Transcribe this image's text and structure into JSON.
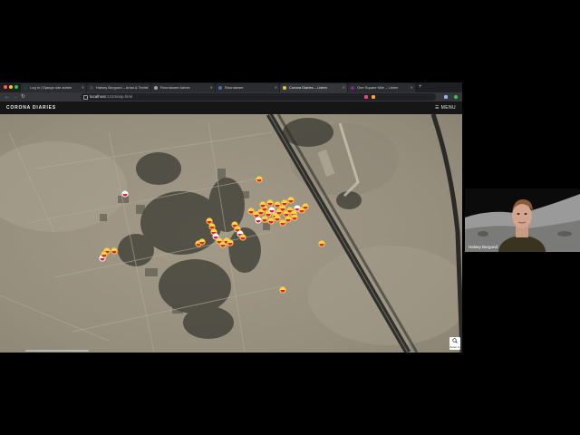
{
  "browser": {
    "traffic_lights": [
      "#ff5f57",
      "#febc2e",
      "#28c840"
    ],
    "tabs": [
      {
        "label": "Log in | Django site admin",
        "favicon_color": "#0c4b33"
      },
      {
        "label": "Halsey Burgund – Artist & Techn",
        "favicon_color": "#444444"
      },
      {
        "label": "Roundware Admin",
        "favicon_color": "#9aa0a6"
      },
      {
        "label": "Roundware",
        "favicon_color": "#4a6fa5"
      },
      {
        "label": "Corona Diaries – Listen",
        "favicon_color": "#e8c440"
      },
      {
        "label": "One Square Mile – Listen",
        "favicon_color": "#7b2d8e"
      }
    ],
    "active_tab_index": 4,
    "new_tab_symbol": "+",
    "nav": {
      "back": "←",
      "forward": "→",
      "reload": "↻"
    },
    "url_host": "localhost",
    "url_path": ":1234/asp.html",
    "extension_colors": [
      "#8ab4f8",
      "#e8467a",
      "#ff9f43",
      "#34c759"
    ]
  },
  "site": {
    "brand": "CORONA DIARIES",
    "menu_label": "☰ MENU"
  },
  "map": {
    "zoom_label": "Zoom In",
    "marker_colors": {
      "outer": "#ffd23f",
      "inner": "#d7263d",
      "white": "#ffffff"
    }
  },
  "webcam": {
    "name": "Halsey Burgund"
  }
}
